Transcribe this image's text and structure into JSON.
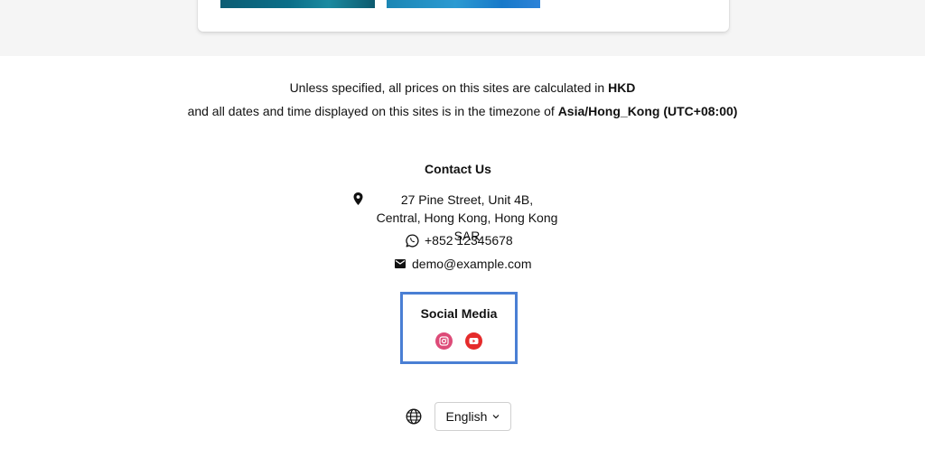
{
  "pricing_notice": {
    "line1_prefix": "Unless specified, all prices on this sites are calculated in ",
    "currency": "HKD",
    "line2_prefix": "and all dates and time displayed on this sites is in the timezone of ",
    "timezone": "Asia/Hong_Kong (UTC+08:00)"
  },
  "contact": {
    "title": "Contact Us",
    "address_line1": "27 Pine Street, Unit 4B,",
    "address_line2": "Central, Hong Kong, Hong Kong SAR",
    "phone": "+852 12345678",
    "email": "demo@example.com",
    "icons": {
      "address": "map-pin-icon",
      "phone": "whatsapp-icon",
      "email": "envelope-icon"
    }
  },
  "social": {
    "title": "Social Media",
    "items": [
      {
        "icon": "instagram-icon",
        "color": "#dd4b78"
      },
      {
        "icon": "youtube-icon",
        "color": "#e52b2b"
      }
    ]
  },
  "language": {
    "icon": "globe-icon",
    "selected": "English"
  },
  "colors": {
    "highlight_border": "#4a7fd4",
    "top_background": "#f5f5f5"
  }
}
